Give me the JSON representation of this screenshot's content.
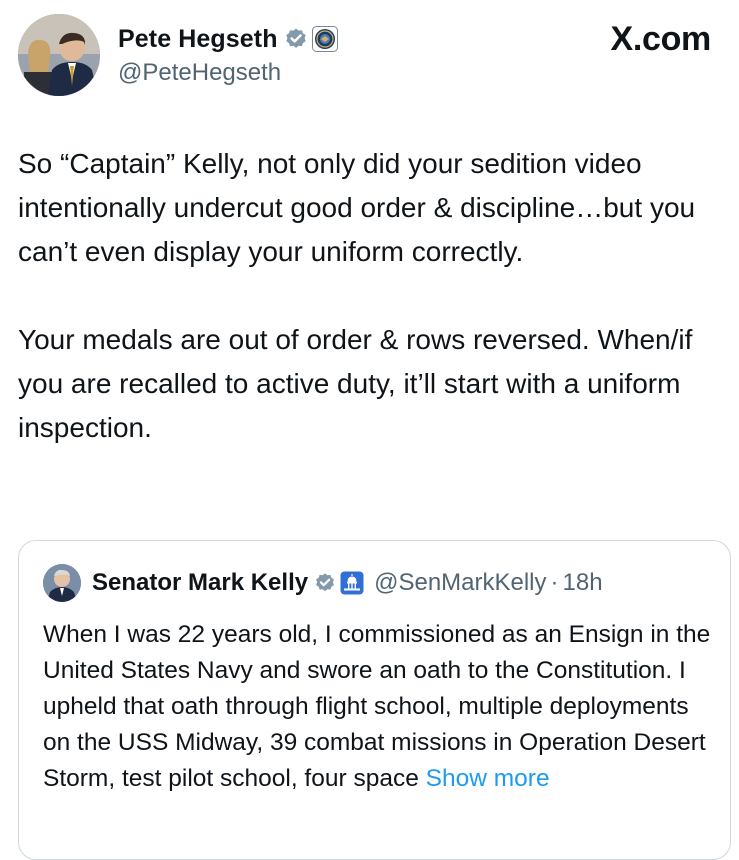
{
  "tweet": {
    "author": {
      "name": "Pete Hegseth",
      "handle": "@PeteHegseth",
      "verified_icon": "verified-badge-gray-icon",
      "affiliation_icon": "department-of-defense-seal-icon"
    },
    "site_label": "X.com",
    "paragraphs": [
      "So “Captain” Kelly, not only did your sedition video intentionally undercut good order & discipline…but you can’t even display your uniform correctly.",
      "Your medals are out of order & rows reversed. When/if you are recalled to active duty, it’ll start with a uniform inspection."
    ]
  },
  "quoted_tweet": {
    "author": {
      "name": "Senator Mark Kelly",
      "handle": "@SenMarkKelly",
      "verified_icon": "verified-badge-gray-icon",
      "affiliation_icon": "us-capitol-icon"
    },
    "separator": "·",
    "time": "18h",
    "text": "When I was 22 years old, I commissioned as an Ensign in the United States Navy and swore an oath to the Constitution. I upheld that oath through flight school, multiple deployments on the USS Midway, 39 combat missions in Operation Desert Storm, test pilot school, four space ",
    "show_more_label": "Show more"
  },
  "colors": {
    "text_primary": "#0f1419",
    "text_secondary": "#536471",
    "link_blue": "#1d9bf0",
    "border": "#cfd9de",
    "verified_gray": "#829aab"
  }
}
